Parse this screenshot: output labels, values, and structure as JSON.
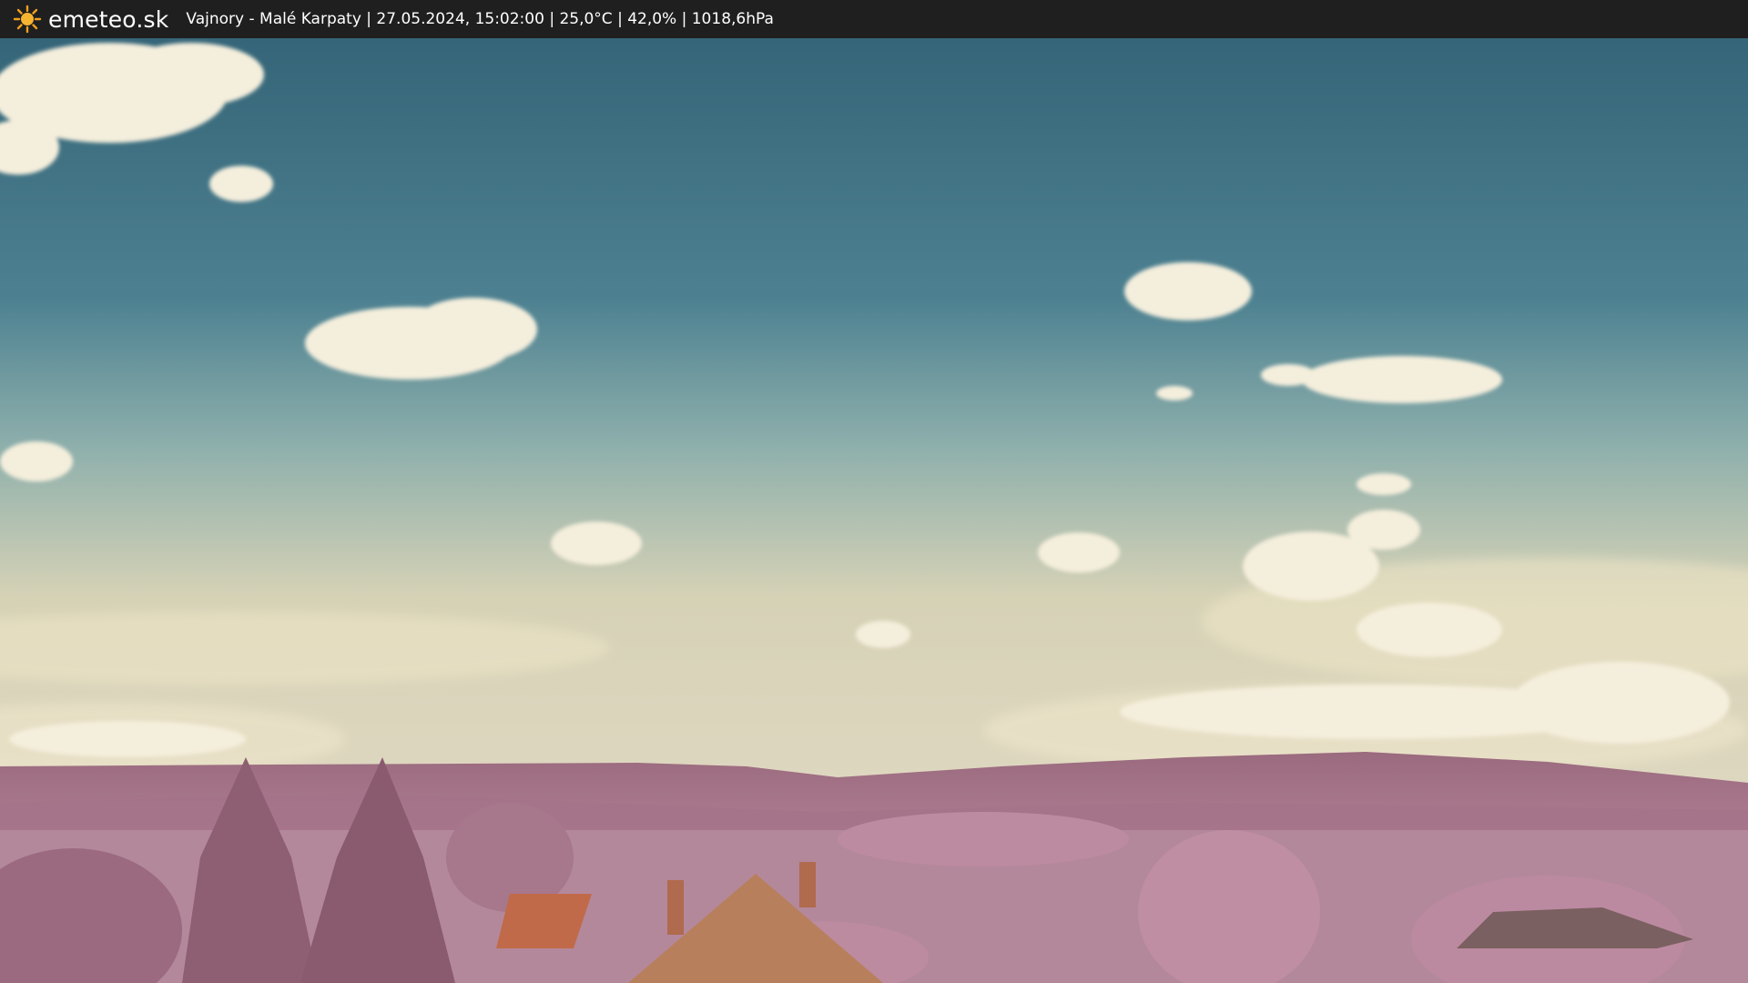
{
  "header": {
    "site_name": "emeteo.sk",
    "logo_icon": "sun-icon",
    "caption": "Vajnory - Malé Karpaty | 27.05.2024, 15:02:00 | 25,0°C | 42,0% | 1018,6hPa"
  },
  "colors": {
    "bar_background": "#1f1f1f",
    "logo_sun": "#f0a020",
    "sky_top": "#3a6b7e",
    "sky_horizon": "#dcd4b8",
    "hills": "#9a6a7e",
    "foliage": "#b8829a",
    "roof": "#c06a4a"
  }
}
